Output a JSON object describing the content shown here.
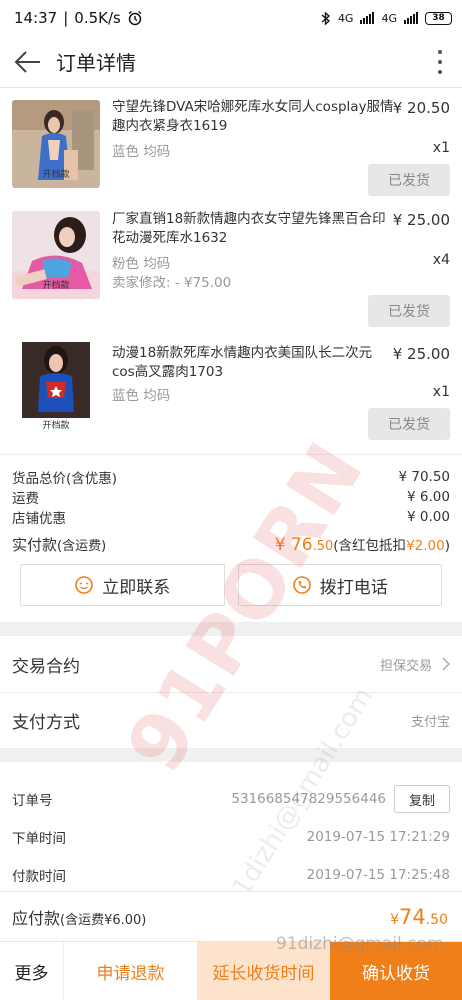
{
  "status": {
    "time": "14:37",
    "speed": "0.5K/s",
    "net1": "4G",
    "net2": "4G",
    "battery": "38"
  },
  "header": {
    "title": "订单详情"
  },
  "products": [
    {
      "thumb_caption": "开档款",
      "title": "守望先锋DVA宋哈娜死库水女同人cosplay服情趣内衣紧身衣1619",
      "price": "¥ 20.50",
      "sku": "蓝色 均码",
      "note": "",
      "qty": "x1",
      "status_btn": "已发货"
    },
    {
      "thumb_caption": "开档款",
      "title": "厂家直销18新款情趣内衣女守望先锋黑百合印花动漫死库水1632",
      "price": "¥ 25.00",
      "sku": "粉色 均码",
      "note": "卖家修改: - ¥75.00",
      "qty": "x4",
      "status_btn": "已发货"
    },
    {
      "thumb_caption": "开档款",
      "title": "动漫18新款死库水情趣内衣美国队长二次元cos高叉露肉1703",
      "price": "¥ 25.00",
      "sku": "蓝色 均码",
      "note": "",
      "qty": "x1",
      "status_btn": "已发货"
    }
  ],
  "summary": {
    "goods_total_label": "货品总价(含优惠)",
    "goods_total": "¥ 70.50",
    "shipping_label": "运费",
    "shipping": "¥ 6.00",
    "discount_label": "店铺优惠",
    "discount": "¥ 0.00",
    "paid_label": "实付款",
    "paid_label_suffix": "(含运费)",
    "paid_big": "¥ 76",
    "paid_small": ".50",
    "paid_note": "(含红包抵扣",
    "paid_note_amount": "¥2.00",
    "paid_note_end": ")"
  },
  "contact": {
    "contact_label": "立即联系",
    "call_label": "拨打电话"
  },
  "info": {
    "contract_label": "交易合约",
    "contract_value": "担保交易",
    "payment_label": "支付方式",
    "payment_value": "支付宝"
  },
  "order": {
    "order_no_label": "订单号",
    "order_no": "531668547829556446",
    "copy_label": "复制",
    "created_label": "下单时间",
    "created": "2019-07-15 17:21:29",
    "paid_label": "付款时间",
    "paid": "2019-07-15 17:25:48"
  },
  "pay_bar": {
    "label": "应付款",
    "label_suffix": "(含运费¥6.00)",
    "amount_big": "74",
    "amount_small": ".50",
    "currency": "¥"
  },
  "actions": {
    "more": "更多",
    "refund": "申请退款",
    "extend": "延长收货时间",
    "confirm": "确认收货"
  },
  "watermark": {
    "brand": "91PORN",
    "site": "91dizhi@gmail.com",
    "email": "91dizhi@gmail.com"
  },
  "colors": {
    "accent": "#f07f1a",
    "accent_light": "#fde3cc",
    "muted": "#999999"
  }
}
